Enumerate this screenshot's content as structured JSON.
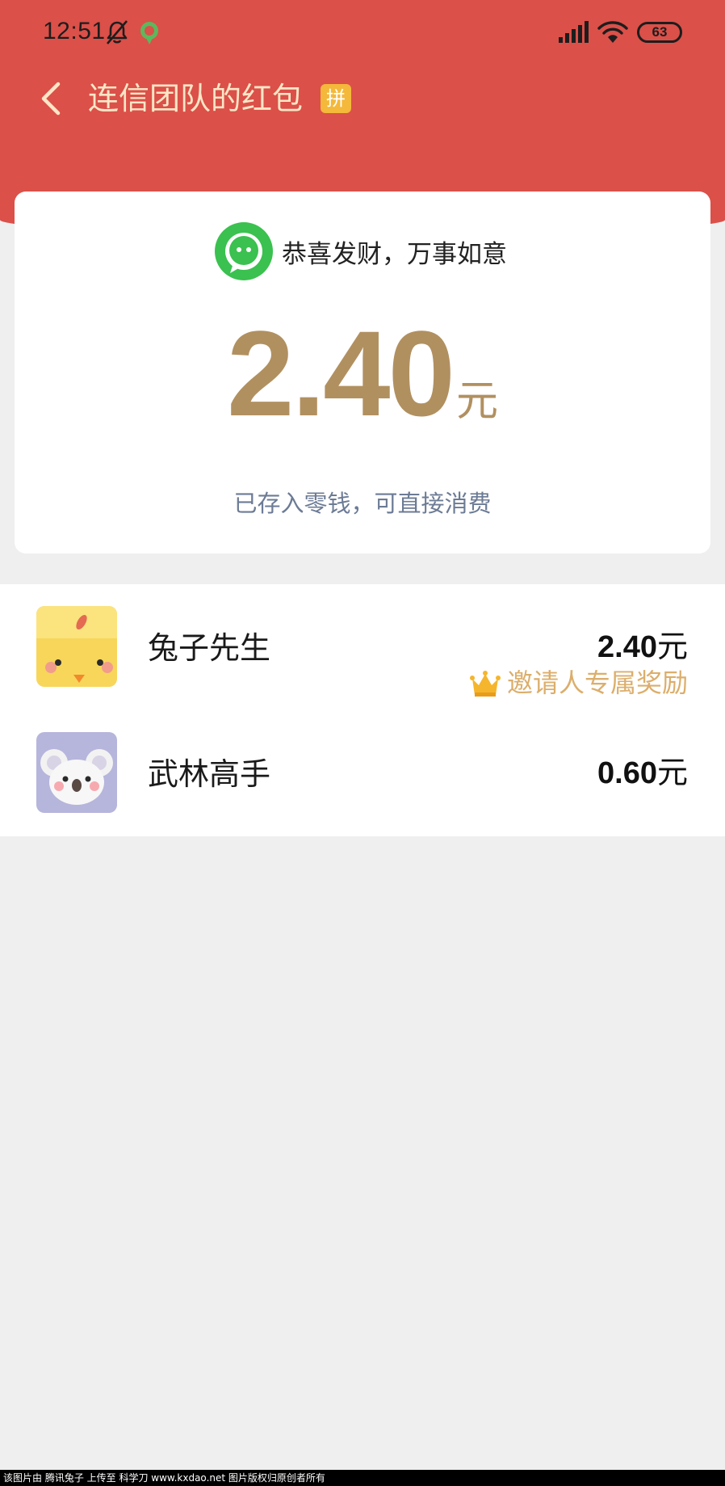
{
  "status_bar": {
    "time": "12:51",
    "battery": "63"
  },
  "header": {
    "title": "连信团队的红包",
    "badge": "拼"
  },
  "card": {
    "greeting": "恭喜发财，万事如意",
    "amount": "2.40",
    "unit": "元",
    "note": "已存入零钱，可直接消费"
  },
  "recipients": [
    {
      "name": "兔子先生",
      "amount": "2.40",
      "unit": "元",
      "reward": "邀请人专属奖励"
    },
    {
      "name": "武林高手",
      "amount": "0.60",
      "unit": "元"
    }
  ],
  "watermark": "该图片由 腾讯兔子 上传至 科学刀 www.kxdao.net 图片版权归原创者所有",
  "colors": {
    "header_red": "#db5049",
    "amount_gold": "#b19060",
    "reward_gold": "#dcae6b",
    "badge_yellow": "#f4b83a",
    "note_blue_gray": "#6c7b95"
  },
  "icons": [
    "chevron-left-icon",
    "bell-off-icon",
    "app-status-icon",
    "signal-icon",
    "wifi-icon",
    "chat-logo-icon",
    "crown-icon"
  ]
}
